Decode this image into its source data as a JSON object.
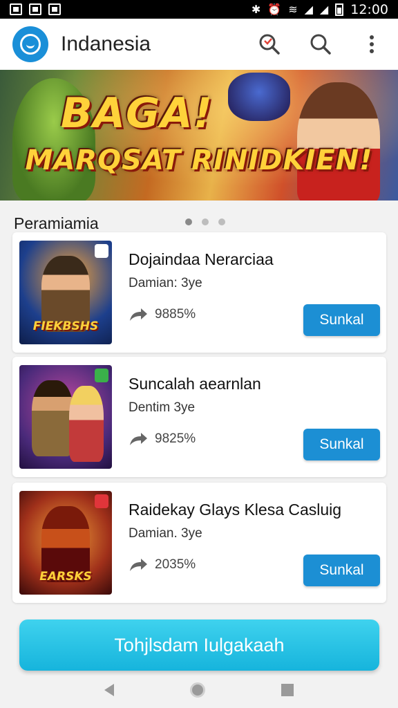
{
  "status_bar": {
    "time": "12:00"
  },
  "app_bar": {
    "title": "Indanesia",
    "icons": [
      "app-logo-icon",
      "badge-search-icon",
      "search-icon",
      "more-vert-icon"
    ]
  },
  "banner": {
    "line1": "BAGA!",
    "line2": "MARQSAT RINIDKIEN!"
  },
  "section": {
    "title": "Peramiamia",
    "page_dots": 3,
    "active_dot": 0
  },
  "cards": [
    {
      "title": "Dojaindaa Nerarciaa",
      "subtitle": "Damian: 3ye",
      "percent": "9885%",
      "button": "Sunkal",
      "thumb_text": "FIEKBSHS",
      "colors": [
        "#1d3f8c",
        "#e8722a"
      ]
    },
    {
      "title": "Suncalah aearnlan",
      "subtitle": "Dentim 3ye",
      "percent": "9825%",
      "button": "Sunkal",
      "thumb_text": "",
      "colors": [
        "#4a2a7a",
        "#c04aa0"
      ]
    },
    {
      "title": "Raidekay Glays Klesa Casluig",
      "subtitle": "Damian. 3ye",
      "percent": "2035%",
      "button": "Sunkal",
      "thumb_text": "EARSKS",
      "colors": [
        "#7a1a0a",
        "#e8a02a"
      ]
    }
  ],
  "cta": {
    "label": "Tohjlsdam Iulgakaah"
  },
  "colors": {
    "accent": "#1c8fd4",
    "cta": "#22bfe3",
    "status_bar": "#000000"
  }
}
